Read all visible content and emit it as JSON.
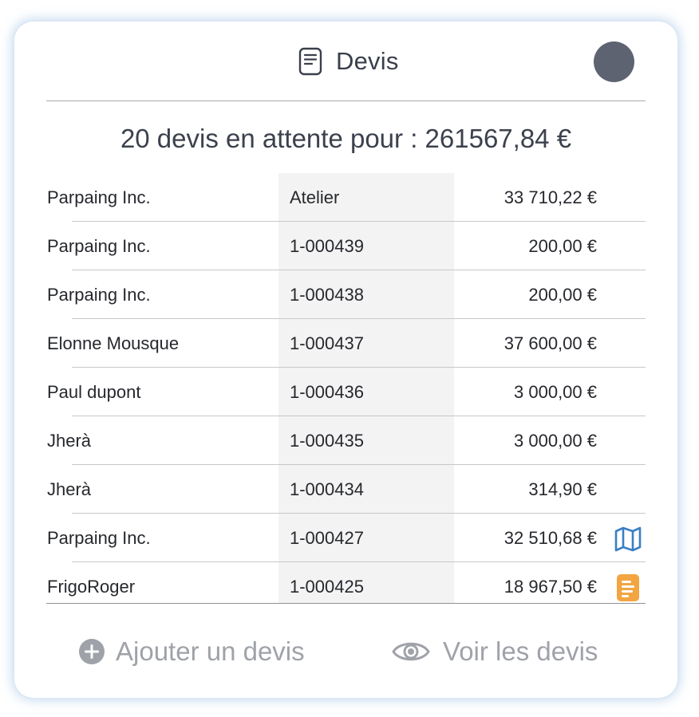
{
  "header": {
    "title": "Devis",
    "title_icon": "document-icon",
    "avatar_color": "#5d6370"
  },
  "summary": "20 devis en attente pour : 261567,84 €",
  "rows": [
    {
      "client": "Parpaing Inc.",
      "number": "Atelier",
      "amount": "33 710,22 €",
      "icon": ""
    },
    {
      "client": "Parpaing Inc.",
      "number": "1-000439",
      "amount": "200,00 €",
      "icon": ""
    },
    {
      "client": "Parpaing Inc.",
      "number": "1-000438",
      "amount": "200,00 €",
      "icon": ""
    },
    {
      "client": "Elonne Mousque",
      "number": "1-000437",
      "amount": "37 600,00 €",
      "icon": ""
    },
    {
      "client": "Paul dupont",
      "number": "1-000436",
      "amount": "3 000,00 €",
      "icon": ""
    },
    {
      "client": "Jherà",
      "number": "1-000435",
      "amount": "3 000,00 €",
      "icon": ""
    },
    {
      "client": "Jherà",
      "number": "1-000434",
      "amount": "314,90 €",
      "icon": ""
    },
    {
      "client": "Parpaing Inc.",
      "number": "1-000427",
      "amount": "32 510,68 €",
      "icon": "map-icon"
    },
    {
      "client": "FrigoRoger",
      "number": "1-000425",
      "amount": "18 967,50 €",
      "icon": "note-icon"
    }
  ],
  "footer": {
    "add_label": "Ajouter un devis",
    "add_icon": "plus-circle-icon",
    "view_label": "Voir les devis",
    "view_icon": "eye-icon"
  },
  "colors": {
    "map_icon": "#3a7fc4",
    "note_icon": "#f2a541",
    "footer_text": "#9fa2a8",
    "column_shade": "#f3f3f3"
  }
}
